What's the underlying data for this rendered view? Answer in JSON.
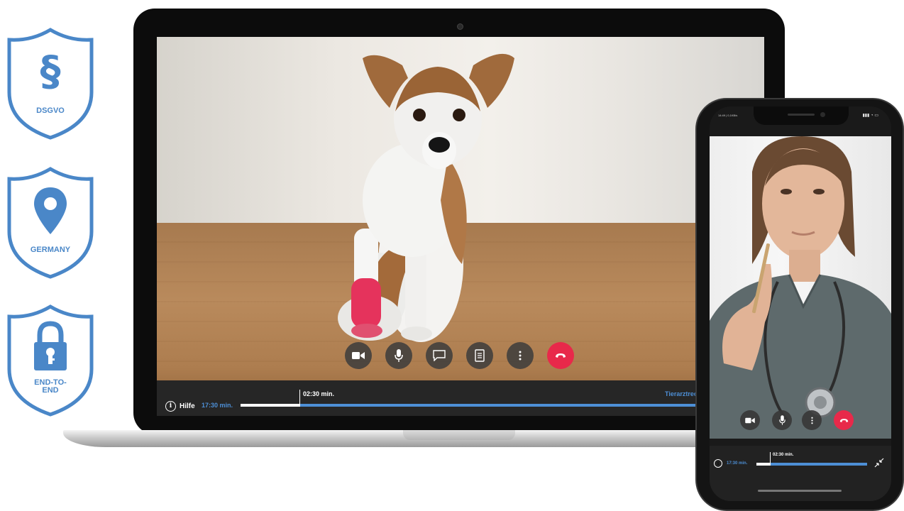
{
  "badges": [
    {
      "label": "DSGVO",
      "icon": "paragraph-icon"
    },
    {
      "label": "GERMANY",
      "icon": "location-pin-icon"
    },
    {
      "label": "END-TO-\nEND",
      "icon": "padlock-key-icon"
    }
  ],
  "colors": {
    "accent_blue": "#4d8fd6",
    "shield_blue": "#4a87c8",
    "end_call_red": "#e8294a"
  },
  "laptop_call": {
    "controls": [
      "video-camera-icon",
      "microphone-icon",
      "chat-icon",
      "document-icon",
      "more-options-icon",
      "end-call-icon"
    ],
    "progress_bar": {
      "help_label": "Hilfe",
      "total_time": "17:30 min.",
      "elapsed_time": "02:30 min.",
      "progress_fraction": 0.11,
      "partner_label": "Tierarztreo"
    }
  },
  "phone_call": {
    "status_time": "14:49 | 0,1KB/s",
    "controls": [
      "video-camera-icon",
      "microphone-icon",
      "more-options-icon",
      "end-call-icon"
    ],
    "progress_bar": {
      "total_time": "17:30 min.",
      "elapsed_time": "02:30 min.",
      "progress_fraction": 0.13
    }
  }
}
